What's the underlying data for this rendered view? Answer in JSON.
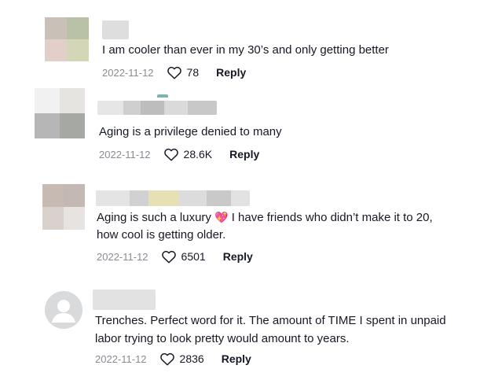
{
  "comments": [
    {
      "text": "I am cooler than ever in my 30’s and only getting better",
      "date": "2022-11-12",
      "likes": "78",
      "reply_label": "Reply"
    },
    {
      "text": "Aging is a privilege denied to many",
      "date": "2022-11-12",
      "likes": "28.6K",
      "reply_label": "Reply"
    },
    {
      "text_line1_a": "Aging is such a luxury",
      "text_emoji": "💖",
      "text_line1_b": "I have friends who didn’t make it to 20,",
      "text_line2": "how cool is getting older.",
      "date": "2022-11-12",
      "likes": "6501",
      "reply_label": "Reply"
    },
    {
      "text_line1": "Trenches. Perfect word for it. The amount of TIME I spent in unpaid",
      "text_line2": "labor trying to look pretty would amount to years.",
      "date": "2022-11-12",
      "likes": "2836",
      "reply_label": "Reply"
    }
  ],
  "icons": {
    "like": "heart-outline-icon",
    "avatar_default": "default-user-icon"
  },
  "colors": {
    "text": "#161823",
    "meta": "#8a8b91",
    "avatar_default_bg": "#d9dadc"
  }
}
